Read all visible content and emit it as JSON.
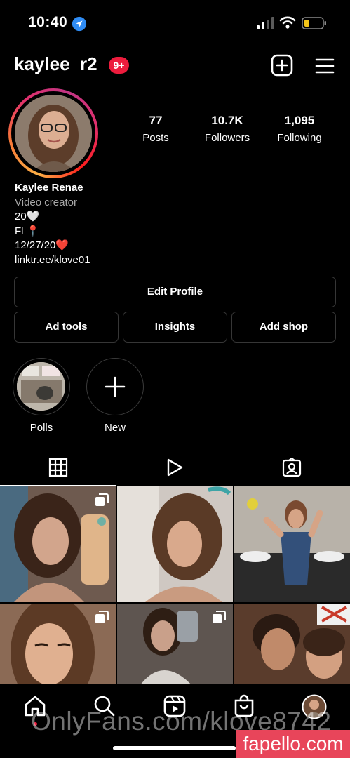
{
  "status_bar": {
    "time": "10:40"
  },
  "header": {
    "username": "kaylee_r2",
    "notification_badge": "9+"
  },
  "stats": {
    "posts": {
      "value": "77",
      "label": "Posts"
    },
    "followers": {
      "value": "10.7K",
      "label": "Followers"
    },
    "following": {
      "value": "1,095",
      "label": "Following"
    }
  },
  "bio": {
    "name": "Kaylee Renae",
    "category": "Video creator",
    "lines": [
      "20🤍",
      "Fl 📍",
      "12/27/20❤️"
    ],
    "link": "linktr.ee/klove01"
  },
  "buttons": {
    "edit_profile": "Edit Profile",
    "ad_tools": "Ad tools",
    "insights": "Insights",
    "add_shop": "Add shop"
  },
  "highlights": [
    {
      "label": "Polls"
    },
    {
      "label": "New"
    }
  ],
  "tabs": [
    "grid-icon",
    "reels-icon",
    "tagged-icon"
  ],
  "nav": [
    "home-icon",
    "search-icon",
    "reels-icon",
    "shop-icon",
    "profile-avatar"
  ],
  "watermark": "OnlyFans.com/klove8742",
  "corner_badge": "fapello.com"
}
